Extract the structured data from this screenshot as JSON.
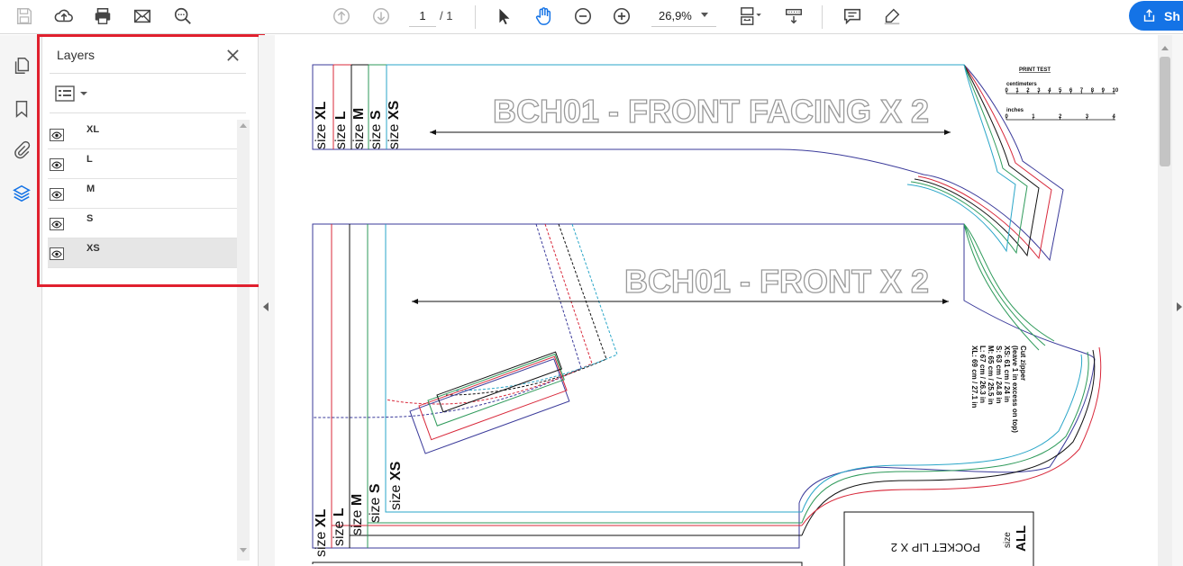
{
  "toolbar": {
    "page_current": "1",
    "page_total": "/ 1",
    "zoom": "26,9%",
    "share_label": "Sh"
  },
  "layers_panel": {
    "title": "Layers",
    "layers": [
      {
        "name": "XL",
        "visible": true,
        "selected": false
      },
      {
        "name": "L",
        "visible": true,
        "selected": false
      },
      {
        "name": "M",
        "visible": true,
        "selected": false
      },
      {
        "name": "S",
        "visible": true,
        "selected": false
      },
      {
        "name": "XS",
        "visible": true,
        "selected": true
      }
    ]
  },
  "document": {
    "piece1_title": "BCH01 - FRONT FACING  X 2",
    "piece2_title": "BCH01 - FRONT X 2",
    "piece3_title": "POCKET LIP X 2",
    "size_prefix": "size",
    "sizes": [
      "XS",
      "S",
      "M",
      "L",
      "XL"
    ],
    "size_all": "ALL",
    "print_test": {
      "title": "PRINT TEST",
      "cm_label": "centimeters",
      "cm_ticks": [
        "0",
        "1",
        "2",
        "3",
        "4",
        "5",
        "6",
        "7",
        "8",
        "9",
        "10"
      ],
      "in_label": "inches",
      "in_ticks": [
        "0",
        "1",
        "2",
        "3",
        "4"
      ]
    },
    "cut_note": [
      "Cut zipper",
      "(leave 1 in excess on top)",
      "XS: 61 cm / 24 in",
      "S: 63 cm / 24.8 in",
      "M: 65 cm / 25.5 in",
      "L: 67 cm / 26.3 in",
      "XL: 69 cm / 27.1 in"
    ]
  },
  "colors": {
    "accent": "#1473e6",
    "highlight": "#e0202e",
    "size_xs": "#2aa6c8",
    "size_s": "#2e9a5a",
    "size_m": "#111111",
    "size_l": "#d8283a",
    "size_xl": "#3a3a9a"
  }
}
